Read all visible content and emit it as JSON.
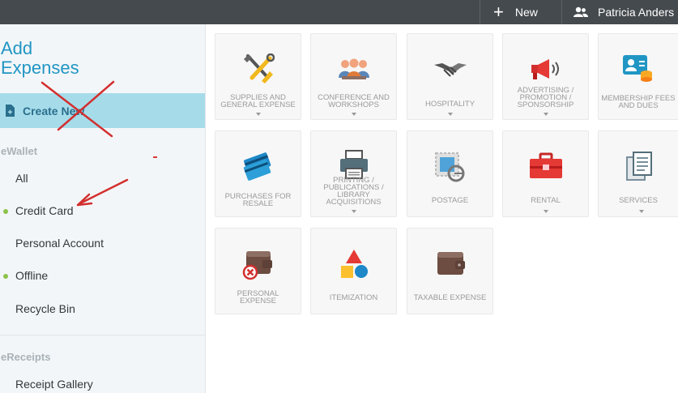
{
  "topbar": {
    "new_label": "New",
    "user_name": "Patricia Anders"
  },
  "sidebar": {
    "title_line1": "Add",
    "title_line2": "Expenses",
    "create_new_label": "Create New",
    "ewallet_label": "eWallet",
    "ewallet_items": [
      {
        "label": "All",
        "has_dot": false
      },
      {
        "label": "Credit Card",
        "has_dot": true
      },
      {
        "label": "Personal Account",
        "has_dot": false
      },
      {
        "label": "Offline",
        "has_dot": true
      },
      {
        "label": "Recycle Bin",
        "has_dot": false
      }
    ],
    "ereceipts_label": "eReceipts",
    "ereceipts_items": [
      {
        "label": "Receipt Gallery"
      }
    ]
  },
  "tiles": [
    {
      "l1": "SUPPLIES AND",
      "l2": "GENERAL EXPENSE",
      "l3": "",
      "l4": "",
      "icon": "tools-icon",
      "has_caret": true
    },
    {
      "l1": "CONFERENCE AND",
      "l2": "WORKSHOPS",
      "l3": "",
      "l4": "",
      "icon": "people-icon",
      "has_caret": true
    },
    {
      "l1": "HOSPITALITY",
      "l2": "",
      "l3": "",
      "l4": "",
      "icon": "handshake-icon",
      "has_caret": true
    },
    {
      "l1": "ADVERTISING /",
      "l2": "PROMOTION /",
      "l3": "SPONSORSHIP",
      "l4": "",
      "icon": "megaphone-icon",
      "has_caret": true
    },
    {
      "l1": "MEMBERSHIP FEES",
      "l2": "AND DUES",
      "l3": "",
      "l4": "",
      "icon": "membership-card-icon",
      "has_caret": false
    },
    {
      "l1": "PURCHASES FOR",
      "l2": "RESALE",
      "l3": "",
      "l4": "",
      "icon": "credit-cards-icon",
      "has_caret": false
    },
    {
      "l1": "PRINTING /",
      "l2": "PUBLICATIONS /",
      "l3": "LIBRARY",
      "l4": "ACQUISITIONS",
      "icon": "printer-icon",
      "has_caret": true
    },
    {
      "l1": "POSTAGE",
      "l2": "",
      "l3": "",
      "l4": "",
      "icon": "stamp-icon",
      "has_caret": false
    },
    {
      "l1": "RENTAL",
      "l2": "",
      "l3": "",
      "l4": "",
      "icon": "toolbox-icon",
      "has_caret": true
    },
    {
      "l1": "SERVICES",
      "l2": "",
      "l3": "",
      "l4": "",
      "icon": "documents-icon",
      "has_caret": true
    },
    {
      "l1": "PERSONAL",
      "l2": "EXPENSE",
      "l3": "",
      "l4": "",
      "icon": "personal-wallet-icon",
      "has_caret": false
    },
    {
      "l1": "ITEMIZATION",
      "l2": "",
      "l3": "",
      "l4": "",
      "icon": "shapes-icon",
      "has_caret": false
    },
    {
      "l1": "TAXABLE EXPENSE",
      "l2": "",
      "l3": "",
      "l4": "",
      "icon": "wallet-icon",
      "has_caret": false
    }
  ],
  "colors": {
    "accent": "#2196c4",
    "highlight": "#a6dcea",
    "topbar": "#454a4e",
    "dot": "#8bc34a",
    "annotation": "#d32f2f"
  }
}
